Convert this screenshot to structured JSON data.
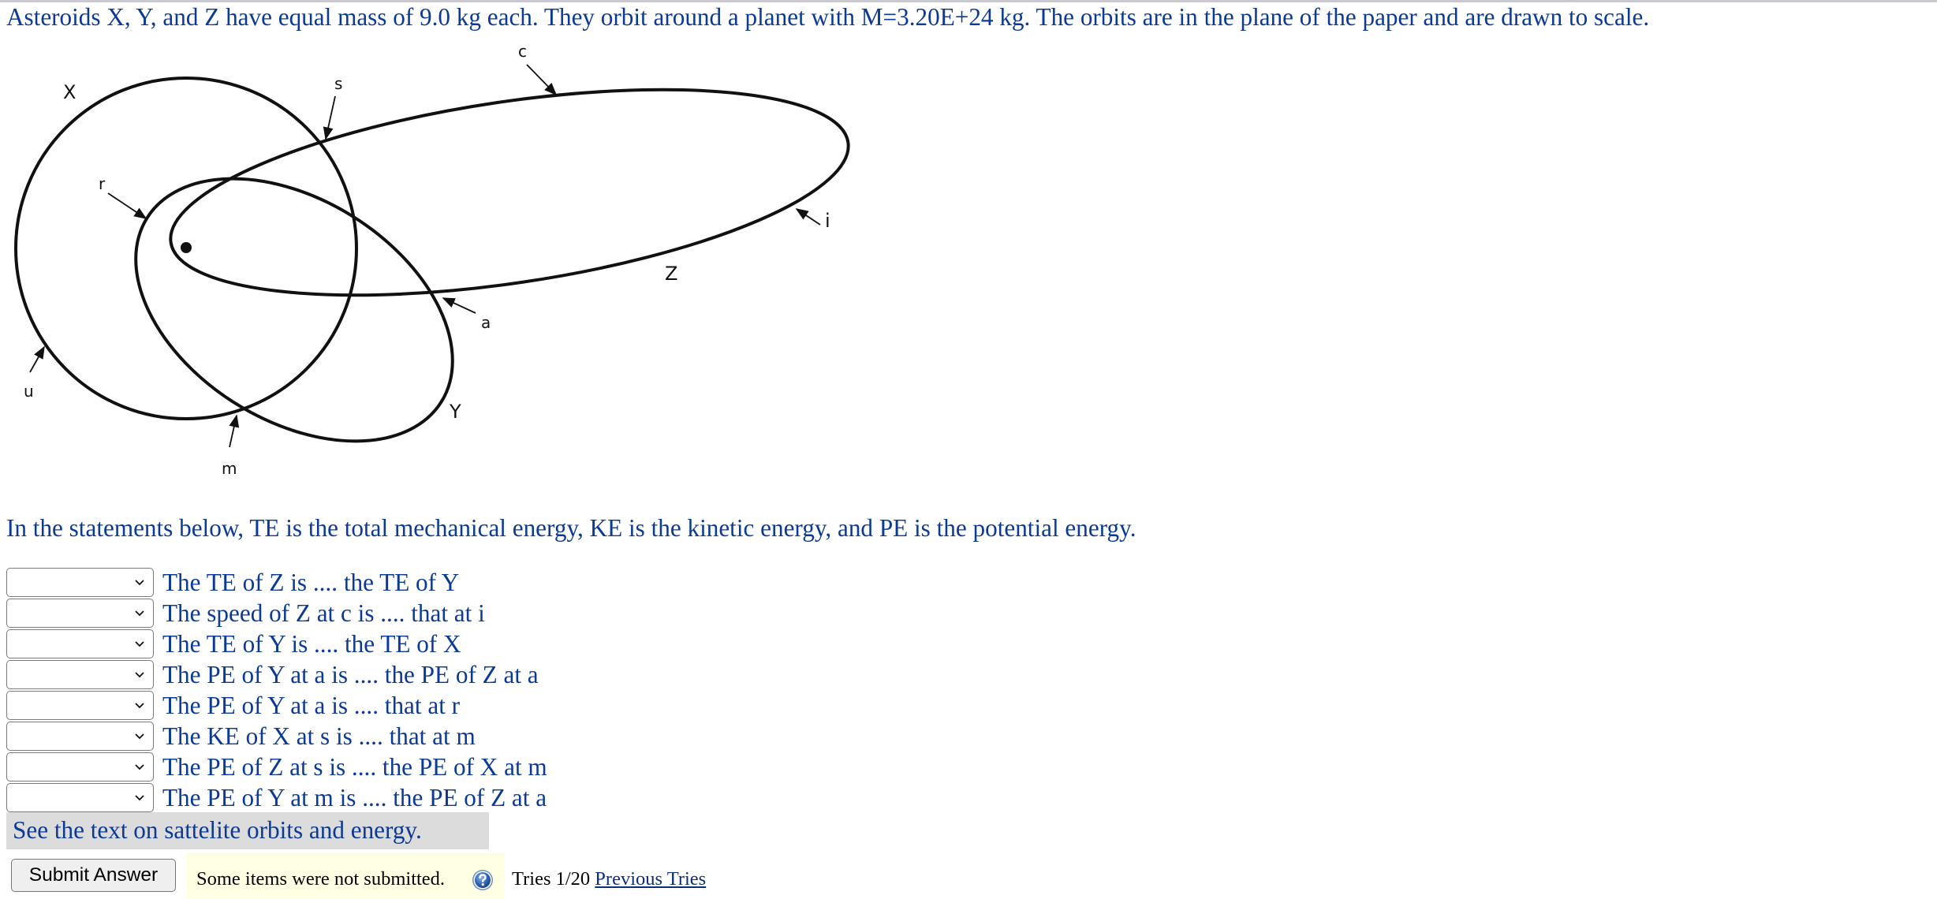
{
  "question": {
    "intro": "Asteroids X, Y, and Z have equal mass of 9.0 kg each. They orbit around a planet with M=3.20E+24 kg. The orbits are in the plane of the paper and are drawn to scale.",
    "definitions": "In the statements below, TE is the total mechanical energy, KE is the kinetic energy, and PE is the potential energy."
  },
  "diagram": {
    "orbit_labels": {
      "x": "X",
      "y": "Y",
      "z": "Z"
    },
    "point_labels": {
      "c": "c",
      "s": "s",
      "r": "r",
      "i": "i",
      "a": "a",
      "u": "u",
      "m": "m"
    },
    "planet": "planet-dot"
  },
  "statements": [
    {
      "selected": "",
      "text": "The TE of Z is .... the TE of Y"
    },
    {
      "selected": "",
      "text": "The speed of Z at c is .... that at i"
    },
    {
      "selected": "",
      "text": "The TE of Y is .... the TE of X"
    },
    {
      "selected": "",
      "text": "The PE of Y at a is .... the PE of Z at a"
    },
    {
      "selected": "",
      "text": "The PE of Y at a is .... that at r"
    },
    {
      "selected": "",
      "text": "The KE of X at s is .... that at m"
    },
    {
      "selected": "",
      "text": "The PE of Z at s is .... the PE of X at m"
    },
    {
      "selected": "",
      "text": "The PE of Y at m is .... the PE of Z at a"
    }
  ],
  "hint": "See the text on sattelite orbits and energy.",
  "footer": {
    "submit_label": "Submit Answer",
    "status_note": "Some items were not submitted.",
    "help_icon": "help-question-icon",
    "tries": "Tries 1/20",
    "previous_tries_link": "Previous Tries"
  },
  "colors": {
    "text": "#0b3a96",
    "hint_bg": "#dcdcdc",
    "note_bg": "#ffffe3"
  }
}
